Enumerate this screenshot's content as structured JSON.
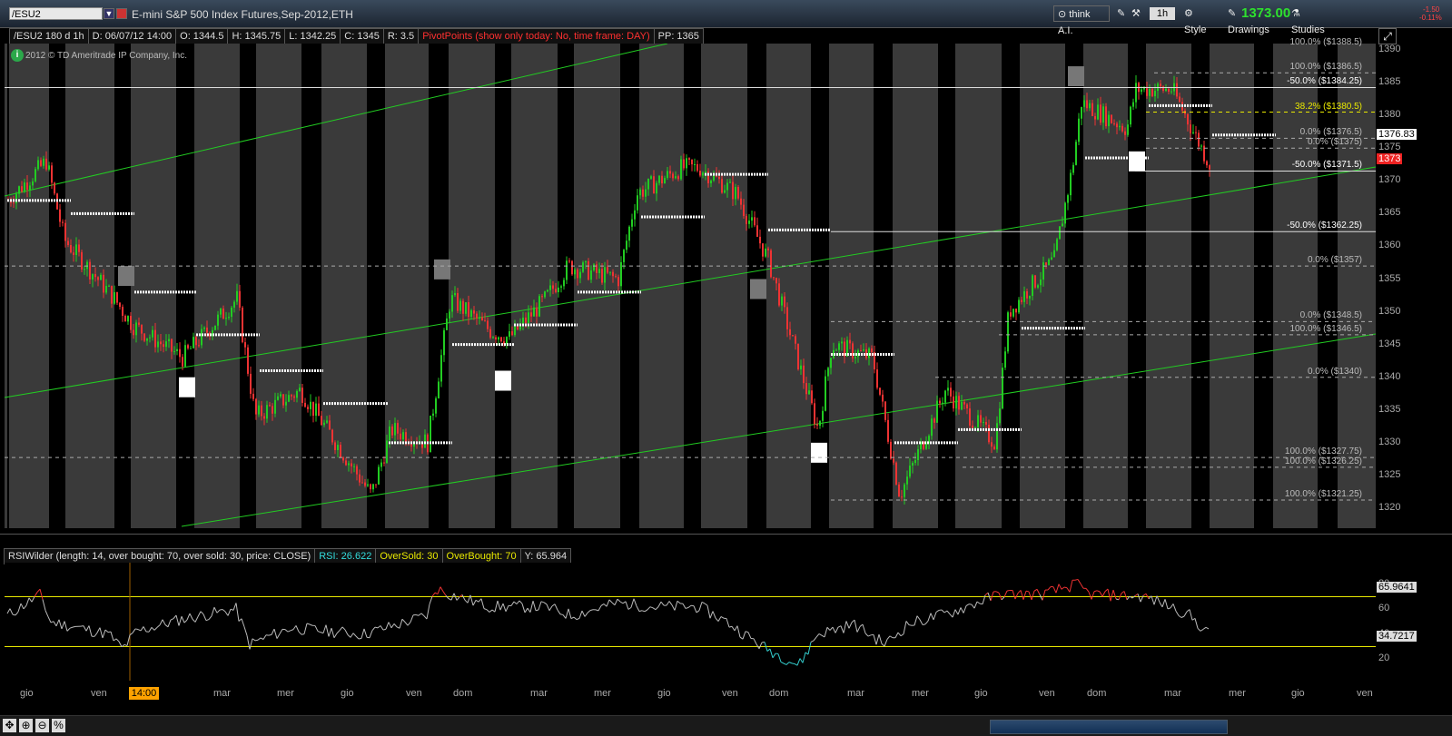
{
  "header": {
    "symbol": "/ESU2",
    "title": "E-mini S&P 500 Index Futures,Sep-2012,ETH",
    "think_ai": "think A.I.",
    "timeframe": "1h",
    "style": "Style",
    "drawings": "Drawings",
    "studies": "Studies",
    "last_price": "1373.00",
    "change": "-1.50",
    "change_pct": "-0.11%"
  },
  "infobar": {
    "symbol_agg": "/ESU2 180 d 1h",
    "date": "D: 06/07/12 14:00",
    "open": "O: 1344.5",
    "high": "H: 1345.75",
    "low": "L: 1342.25",
    "close": "C: 1345",
    "range": "R: 3.5",
    "pivot_study": "PivotPoints (show only today: No, time frame: DAY)",
    "pp": "PP: 1365"
  },
  "copyright": "2012 © TD Ameritrade IP Company, Inc.",
  "price_axis": {
    "ticks": [
      "1390",
      "1385",
      "1380",
      "1375",
      "1370",
      "1365",
      "1360",
      "1355",
      "1350",
      "1345",
      "1340",
      "1335",
      "1330",
      "1325",
      "1320"
    ],
    "current_price_box": "1376.83",
    "last_price_box": "1373"
  },
  "fib_labels": [
    {
      "text": "100.0% ($1388.5)",
      "price": 1390.3,
      "color": "#bbbbbb"
    },
    {
      "text": "100.0% ($1386.5)",
      "price": 1386.5,
      "color": "#bbbbbb"
    },
    {
      "text": "-50.0% ($1384.25)",
      "price": 1384.25,
      "color": "#ffffff"
    },
    {
      "text": "38.2% ($1380.5)",
      "price": 1380.5,
      "color": "#e8e800"
    },
    {
      "text": "0.0% ($1376.5)",
      "price": 1376.5,
      "color": "#bbbbbb"
    },
    {
      "text": "0.0% ($1375)",
      "price": 1375,
      "color": "#bbbbbb"
    },
    {
      "text": "-50.0% ($1371.5)",
      "price": 1371.5,
      "color": "#ffffff"
    },
    {
      "text": "-50.0% ($1362.25)",
      "price": 1362.25,
      "color": "#ffffff"
    },
    {
      "text": "0.0% ($1357)",
      "price": 1357,
      "color": "#bbbbbb"
    },
    {
      "text": "0.0% ($1348.5)",
      "price": 1348.5,
      "color": "#bbbbbb"
    },
    {
      "text": "100.0% ($1346.5)",
      "price": 1346.5,
      "color": "#bbbbbb"
    },
    {
      "text": "0.0% ($1340)",
      "price": 1340,
      "color": "#bbbbbb"
    },
    {
      "text": "100.0% ($1327.75)",
      "price": 1327.75,
      "color": "#bbbbbb"
    },
    {
      "text": "100.0% ($1326.25)",
      "price": 1326.25,
      "color": "#bbbbbb"
    },
    {
      "text": "100.0% ($1321.25)",
      "price": 1321.25,
      "color": "#bbbbbb"
    }
  ],
  "rsi": {
    "study": "RSIWilder (length: 14, over bought: 70, over sold: 30, price: CLOSE)",
    "rsi_value": "RSI: 26.622",
    "oversold": "OverSold: 30",
    "overbought": "OverBought: 70",
    "y": "Y: 65.964",
    "axis_ticks": [
      "80",
      "60",
      "40",
      "20"
    ],
    "box_high": "65.9641",
    "box_low": "34.7217",
    "overbought_level": 70,
    "oversold_level": 30
  },
  "x_axis": {
    "labels": [
      "gio",
      "ven",
      "mar",
      "mer",
      "gio",
      "ven",
      "dom",
      "mar",
      "mer",
      "gio",
      "ven",
      "dom",
      "mar",
      "mer",
      "gio",
      "ven",
      "dom",
      "mar",
      "mer",
      "gio",
      "ven"
    ],
    "highlight": "14:00"
  },
  "bottom": {
    "zoom_label": "%"
  },
  "colors": {
    "bull": "#22cc22",
    "bear": "#ee3333",
    "channel": "#22cc22",
    "overbought": "#e8e800",
    "rsi_line": "#bbbbbb",
    "rsi_ob": "#ee3333",
    "rsi_os": "#33cccc"
  }
}
